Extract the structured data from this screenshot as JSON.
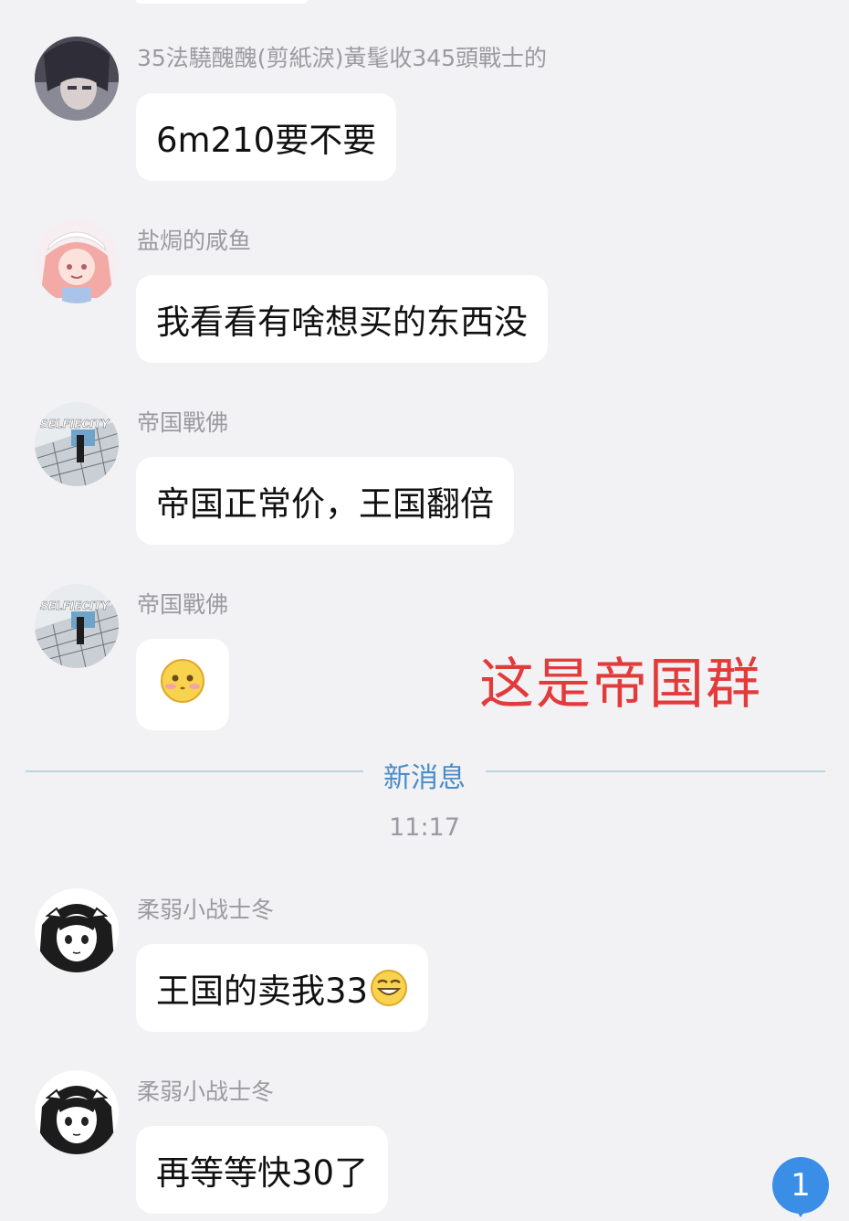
{
  "messages": [
    {
      "sender": "35法驍醜醜(剪紙淚)黃髦收345頭戰士的",
      "text": "6m210要不要",
      "avatar_icon": "anime-dark-hair-avatar-icon"
    },
    {
      "sender": "盐焗的咸鱼",
      "text": "我看看有啥想买的东西没",
      "avatar_icon": "anime-pink-hair-avatar-icon"
    },
    {
      "sender": "帝国戰佛",
      "text": "帝国正常价，王国翻倍",
      "avatar_icon": "selfiecity-avatar-icon",
      "avatar_text": "SELFIECITY"
    },
    {
      "sender": "帝国戰佛",
      "text": "",
      "avatar_icon": "selfiecity-avatar-icon",
      "avatar_text": "SELFIECITY",
      "emoji": "shy-blush-emoji-icon"
    },
    {
      "sender": "柔弱小战士冬",
      "text": "王国的卖我33",
      "avatar_icon": "manga-girl-avatar-icon",
      "emoji": "grin-emoji-icon"
    },
    {
      "sender": "柔弱小战士冬",
      "text": "再等等快30了",
      "avatar_icon": "manga-girl-avatar-icon"
    }
  ],
  "divider": {
    "label": "新消息"
  },
  "timestamp": "11:17",
  "overlay_note": "这是帝国群",
  "unread_badge": {
    "count": "1"
  },
  "colors": {
    "accent": "#3a8ee6",
    "note": "#e23b3b",
    "background": "#f2f2f4"
  }
}
